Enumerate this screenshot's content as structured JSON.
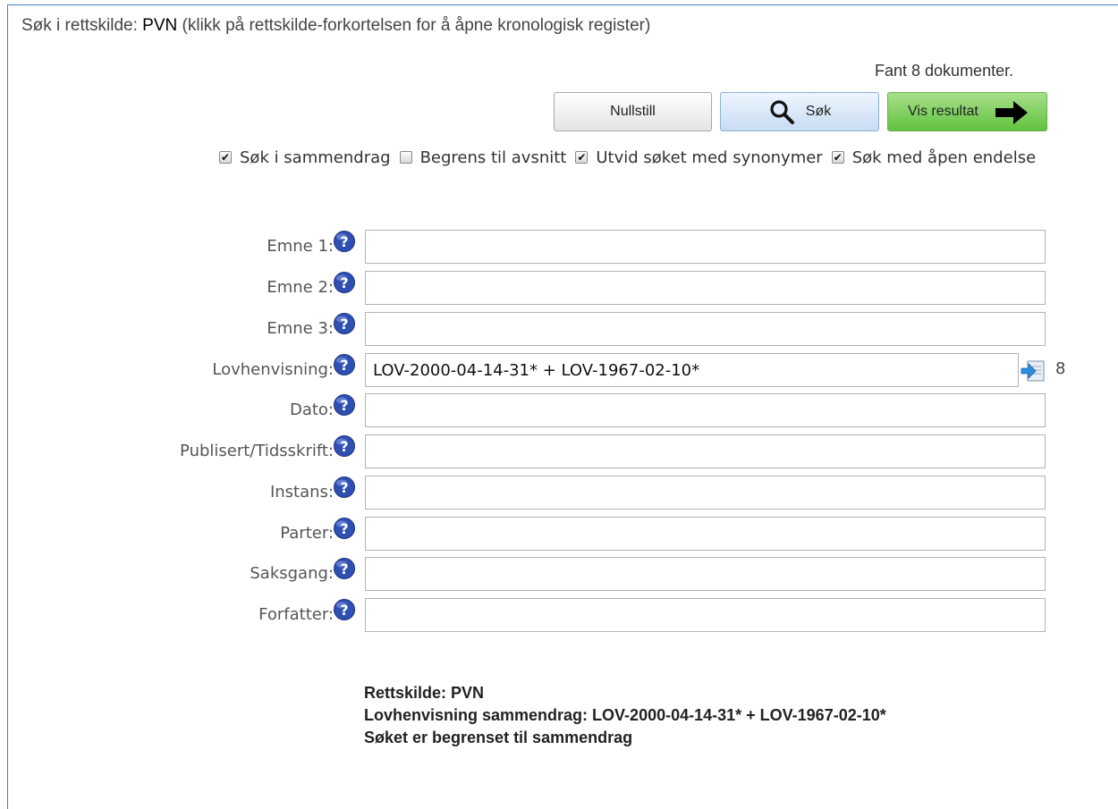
{
  "header": {
    "prefix": "Søk i rettskilde:",
    "source_code": "PVN",
    "hint": "(klikk på rettskilde-forkortelsen for å åpne kronologisk register)"
  },
  "result_count_text": "Fant 8 dokumenter.",
  "buttons": {
    "reset": "Nullstill",
    "search": "Søk",
    "show_results": "Vis resultat"
  },
  "options": [
    {
      "label": "Søk i sammendrag",
      "checked": true
    },
    {
      "label": "Begrens til avsnitt",
      "checked": false
    },
    {
      "label": "Utvid søket med synonymer",
      "checked": true
    },
    {
      "label": "Søk med åpen endelse",
      "checked": true
    }
  ],
  "fields": {
    "emne1": {
      "label": "Emne 1:",
      "value": ""
    },
    "emne2": {
      "label": "Emne 2:",
      "value": ""
    },
    "emne3": {
      "label": "Emne 3:",
      "value": ""
    },
    "lovhenvisning": {
      "label": "Lovhenvisning:",
      "value": "LOV-2000-04-14-31* + LOV-1967-02-10*",
      "count": "8"
    },
    "dato": {
      "label": "Dato:",
      "value": ""
    },
    "publisert": {
      "label": "Publisert/Tidsskrift:",
      "value": ""
    },
    "instans": {
      "label": "Instans:",
      "value": ""
    },
    "parter": {
      "label": "Parter:",
      "value": ""
    },
    "saksgang": {
      "label": "Saksgang:",
      "value": ""
    },
    "forfatter": {
      "label": "Forfatter:",
      "value": ""
    }
  },
  "summary": {
    "line1": "Rettskilde: PVN",
    "line2": "Lovhenvisning sammendrag: LOV-2000-04-14-31* + LOV-1967-02-10*",
    "line3": "Søket er begrenset til sammendrag"
  },
  "icons": {
    "help": "question-circle-icon",
    "search": "magnifier-icon",
    "arrow": "arrow-right-icon",
    "go": "go-to-list-icon"
  },
  "colors": {
    "help_blue": "#2f4fb3",
    "show_green": "#62c23f",
    "search_blue": "#c7dcf3",
    "frame_blue": "#4a7fc1"
  }
}
